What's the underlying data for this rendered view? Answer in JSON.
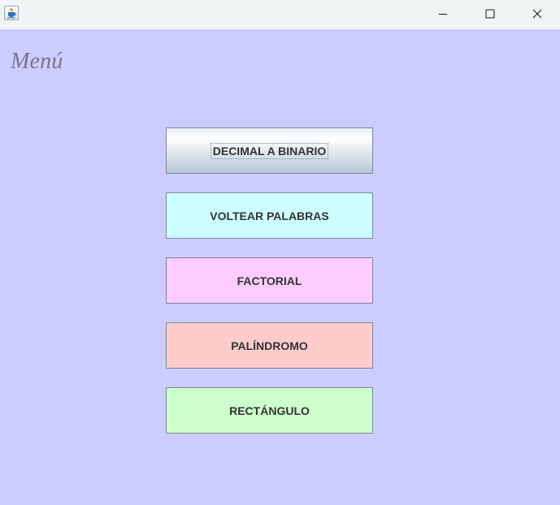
{
  "window": {
    "title": "",
    "icon": "java-cup-icon",
    "controls": [
      "minimize",
      "maximize",
      "close"
    ]
  },
  "header": {
    "title": "Menú"
  },
  "menu": {
    "buttons": [
      {
        "label": "DECIMAL A BINARIO",
        "color": "#dbe3eb",
        "focused": true
      },
      {
        "label": "VOLTEAR PALABRAS",
        "color": "#ccffff"
      },
      {
        "label": "FACTORIAL",
        "color": "#ffccff"
      },
      {
        "label": "PALÍNDROMO",
        "color": "#ffcccc"
      },
      {
        "label": "RECTÁNGULO",
        "color": "#ccffcc"
      }
    ]
  },
  "colors": {
    "background": "#ccccff",
    "titlebar": "#eff4f5",
    "title_text": "#76768a",
    "button_text": "#333333"
  }
}
